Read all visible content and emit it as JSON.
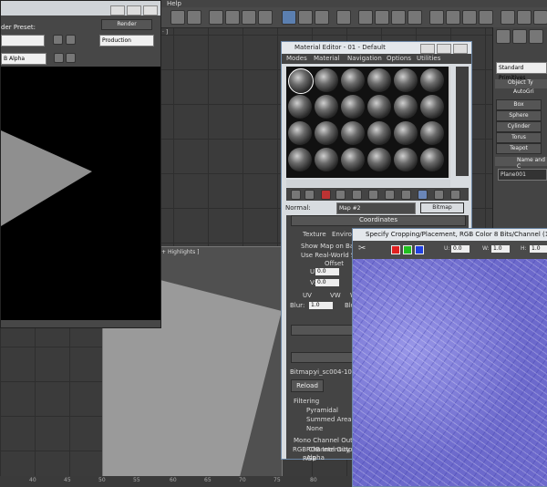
{
  "app": {
    "menu_help": "Help",
    "viewport_top_label": "· ]",
    "viewport_bottom_label": "Smooth + Highlights ]"
  },
  "render_window": {
    "preset_label": "der Preset:",
    "render_button": "Render",
    "production_value": "Production",
    "channel_value": "B Alpha"
  },
  "command_panel": {
    "dropdown_value": "Standard Primitives",
    "rollout_object_type": "Object Ty",
    "autogrid": "AutoGri",
    "buttons": [
      "Box",
      "Sphere",
      "Cylinder",
      "Torus",
      "Teapot"
    ],
    "rollout_name_color": "Name and C",
    "object_name": "Plane001"
  },
  "material_editor": {
    "title": "Material Editor - 01 - Default",
    "menu": [
      "Modes",
      "Material",
      "Navigation",
      "Options",
      "Utilities"
    ],
    "normal_label": "Normal:",
    "map_value": "Map #2",
    "map_type": "Bitmap",
    "coordinates_title": "Coordinates",
    "texture_option": "Texture",
    "environ_option": "Enviro",
    "show_map_label": "Show Map on Ba",
    "real_world_label": "Use Real-World Sc",
    "offset_label": "Offset",
    "u_label": "U:",
    "u_value": "0.0",
    "v_label": "V:",
    "v_value": "0.0",
    "uv_label": "UV",
    "vw_label": "VW",
    "w_label": "W",
    "blur_label": "Blur:",
    "blur_value": "1.0",
    "blur_offset_label": "Blu",
    "bitmap_label": "Bitmap:",
    "bitmap_value": "yi_sc004-1022",
    "reload_button": "Reload",
    "filtering_title": "Filtering",
    "filtering_options": [
      "Pyramidal",
      "Summed Area",
      "None"
    ],
    "mono_title": "Mono Channel Outpu",
    "mono_options": [
      "RGB Intensity",
      "Alpha"
    ],
    "rgb_title": "RGB Channel Output",
    "rgb_option": "RGB"
  },
  "crop_window": {
    "title": "Specify Cropping/Placement, RGB Color 8 Bits/Channel (1:1)",
    "u_label": "U:",
    "u_value": "0.0",
    "w_label": "W:",
    "w_value": "1.0",
    "h_label": "H:",
    "h_value": "1.0"
  },
  "ruler": {
    "ticks": [
      "40",
      "45",
      "50",
      "55",
      "60",
      "65",
      "70",
      "75",
      "80"
    ]
  },
  "colors": {
    "normal_map": "#7c7ad8",
    "window_border": "#6b86a5",
    "viewport": "#3b3b3b"
  }
}
